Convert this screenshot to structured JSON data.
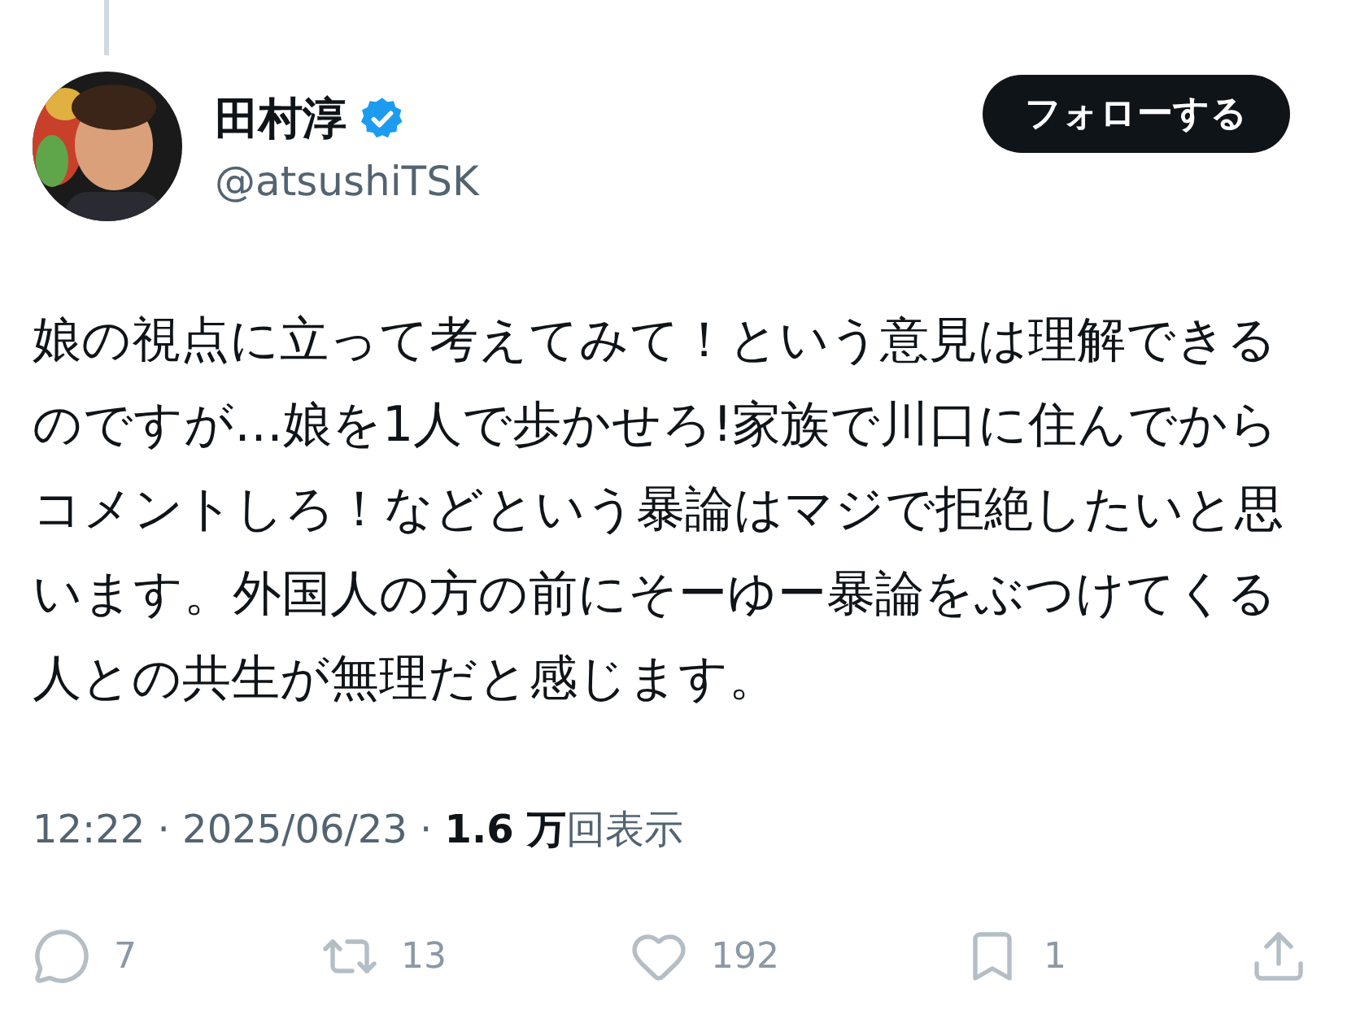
{
  "author": {
    "name": "田村淳",
    "verified": true,
    "handle": "@atsushiTSK"
  },
  "follow_button": {
    "label": "フォローする"
  },
  "post": {
    "text": "娘の視点に立って考えてみて！という意見は理解できるのですが…娘を1人で歩かせろ!家族で川口に住んでからコメントしろ！などという暴論はマジで拒絶したいと思います。外国人の方の前にそーゆー暴論をぶつけてくる人との共生が無理だと感じます。"
  },
  "meta": "12:22 · 2025/06/23 · **1.6 万**回表示",
  "actions": [
    {
      "kind": "reply",
      "count": "7"
    },
    {
      "kind": "repost",
      "count": "13"
    },
    {
      "kind": "like",
      "count": "192"
    },
    {
      "kind": "bookmark",
      "count": "1"
    },
    {
      "kind": "share"
    }
  ]
}
